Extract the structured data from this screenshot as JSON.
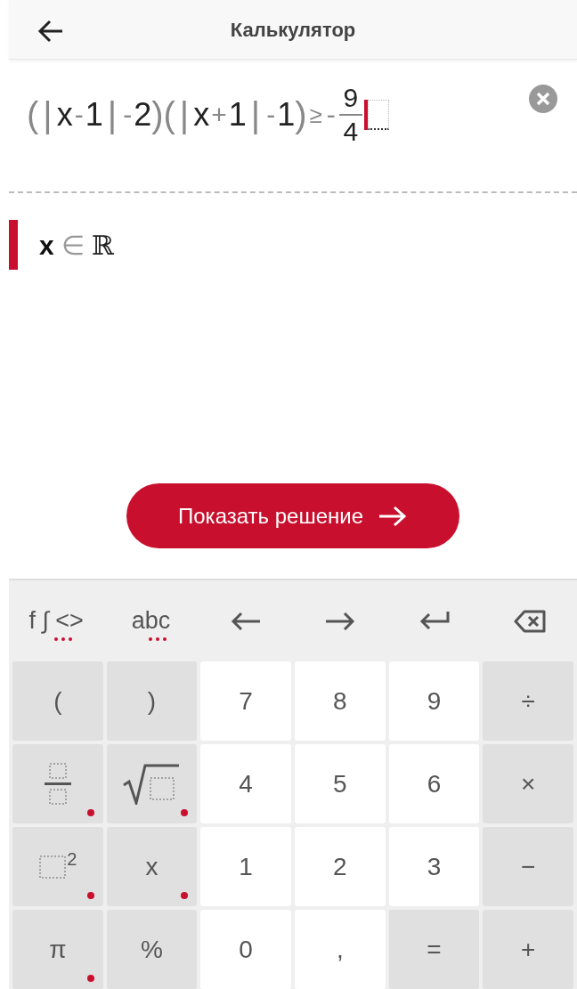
{
  "header": {
    "title": "Калькулятор"
  },
  "editor": {
    "expression": [
      {
        "kind": "paren",
        "text": "("
      },
      {
        "kind": "bar",
        "text": "|"
      },
      {
        "kind": "symbol",
        "text": "x"
      },
      {
        "kind": "operator",
        "text": "-"
      },
      {
        "kind": "symbol",
        "text": "1"
      },
      {
        "kind": "bar",
        "text": "|"
      },
      {
        "kind": "operator",
        "text": "-"
      },
      {
        "kind": "symbol",
        "text": "2"
      },
      {
        "kind": "paren",
        "text": ")"
      },
      {
        "kind": "paren",
        "text": "("
      },
      {
        "kind": "bar",
        "text": "|"
      },
      {
        "kind": "symbol",
        "text": "x"
      },
      {
        "kind": "operator",
        "text": "+"
      },
      {
        "kind": "symbol",
        "text": "1"
      },
      {
        "kind": "bar",
        "text": "|"
      },
      {
        "kind": "operator",
        "text": "-"
      },
      {
        "kind": "symbol",
        "text": "1"
      },
      {
        "kind": "paren",
        "text": ")"
      },
      {
        "kind": "relation",
        "text": "≥"
      },
      {
        "kind": "operator",
        "text": "-"
      },
      {
        "kind": "fraction",
        "numerator": "9",
        "denominator": "4"
      },
      {
        "kind": "cursor"
      },
      {
        "kind": "slot"
      }
    ]
  },
  "result": {
    "variable": "x",
    "relation": "∈",
    "set": "ℝ"
  },
  "solution_button": {
    "label": "Показать решение"
  },
  "toolbar": [
    {
      "kind": "text",
      "label": "f ∫ <>",
      "more": true
    },
    {
      "kind": "text",
      "label": "abc",
      "more": true
    },
    {
      "kind": "left"
    },
    {
      "kind": "right"
    },
    {
      "kind": "enter"
    },
    {
      "kind": "backspace"
    }
  ],
  "keys": [
    {
      "kind": "text",
      "label": "(",
      "dark": true,
      "more": false
    },
    {
      "kind": "text",
      "label": ")",
      "dark": true,
      "more": false
    },
    {
      "kind": "text",
      "label": "7",
      "dark": false,
      "more": false
    },
    {
      "kind": "text",
      "label": "8",
      "dark": false,
      "more": false
    },
    {
      "kind": "text",
      "label": "9",
      "dark": false,
      "more": false
    },
    {
      "kind": "text",
      "label": "÷",
      "dark": true,
      "more": false
    },
    {
      "kind": "fraction",
      "dark": true,
      "more": true
    },
    {
      "kind": "sqrt",
      "dark": true,
      "more": true
    },
    {
      "kind": "text",
      "label": "4",
      "dark": false,
      "more": false
    },
    {
      "kind": "text",
      "label": "5",
      "dark": false,
      "more": false
    },
    {
      "kind": "text",
      "label": "6",
      "dark": false,
      "more": false
    },
    {
      "kind": "text",
      "label": "×",
      "dark": true,
      "more": false
    },
    {
      "kind": "power",
      "exponent": "2",
      "dark": true,
      "more": true
    },
    {
      "kind": "text",
      "label": "x",
      "dark": true,
      "more": true
    },
    {
      "kind": "text",
      "label": "1",
      "dark": false,
      "more": false
    },
    {
      "kind": "text",
      "label": "2",
      "dark": false,
      "more": false
    },
    {
      "kind": "text",
      "label": "3",
      "dark": false,
      "more": false
    },
    {
      "kind": "text",
      "label": "−",
      "dark": true,
      "more": false
    },
    {
      "kind": "text",
      "label": "π",
      "dark": true,
      "more": true
    },
    {
      "kind": "text",
      "label": "%",
      "dark": true,
      "more": false
    },
    {
      "kind": "text",
      "label": "0",
      "dark": false,
      "more": false
    },
    {
      "kind": "text",
      "label": ",",
      "dark": false,
      "more": false
    },
    {
      "kind": "text",
      "label": "=",
      "dark": true,
      "more": false
    },
    {
      "kind": "text",
      "label": "+",
      "dark": true,
      "more": false
    }
  ]
}
